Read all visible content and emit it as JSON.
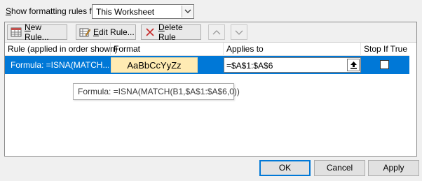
{
  "top": {
    "show_label_pre": "",
    "show_label_ul": "S",
    "show_label_post": "how formatting rules for:",
    "scope_value": "This Worksheet"
  },
  "toolbar": {
    "new_rule_ul": "N",
    "new_rule_rest": "ew Rule...",
    "edit_rule_ul": "E",
    "edit_rule_rest": "dit Rule...",
    "delete_rule_ul": "D",
    "delete_rule_rest": "elete Rule",
    "move_up_icon": "triangle-up-icon",
    "move_down_icon": "triangle-down-icon"
  },
  "table": {
    "headers": {
      "rule": "Rule (applied in order shown)",
      "format": "Format",
      "applies": "Applies to",
      "stop": "Stop If True"
    },
    "rows": [
      {
        "rule": "Formula: =ISNA(MATCH...",
        "preview": "AaBbCcYyZz",
        "applies_to": "=$A$1:$A$6",
        "stop_if_true": false
      }
    ]
  },
  "tooltip": "Formula: =ISNA(MATCH(B1,$A$1:$A$6,0))",
  "footer": {
    "ok": "OK",
    "cancel": "Cancel",
    "apply": "Apply"
  },
  "colors": {
    "selection": "#0078d7",
    "preview_fill": "#ffebb3",
    "delete_x": "#c62828"
  }
}
